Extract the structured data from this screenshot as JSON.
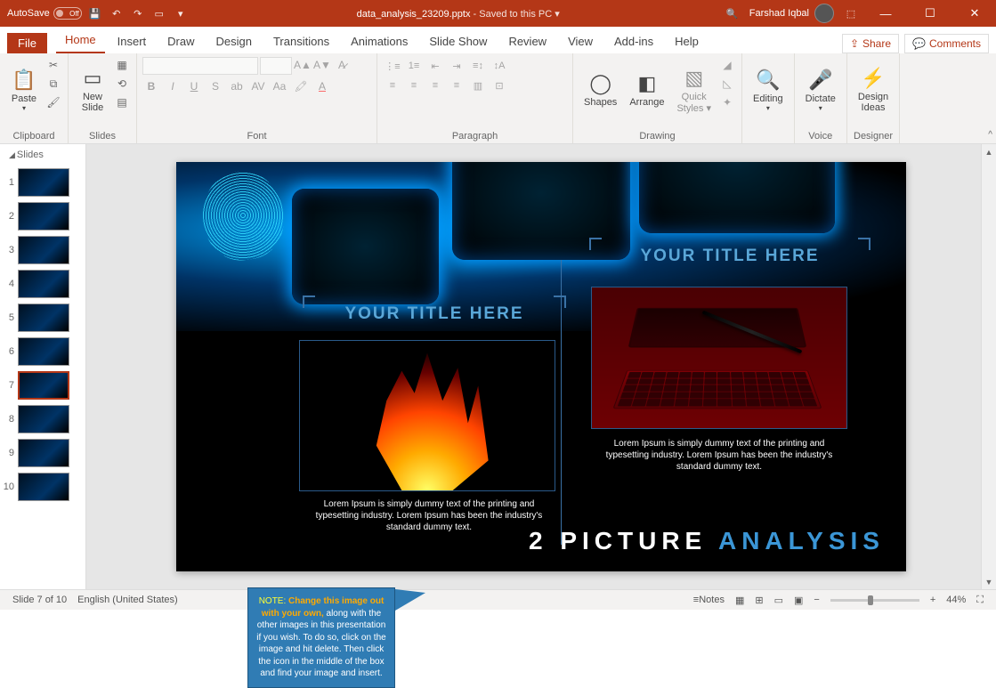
{
  "titlebar": {
    "autosave_label": "AutoSave",
    "autosave_state": "Off",
    "filename": "data_analysis_23209.pptx",
    "saved_status": " - Saved to this PC ▾",
    "user": "Farshad Iqbal"
  },
  "tabs": {
    "file": "File",
    "items": [
      "Home",
      "Insert",
      "Draw",
      "Design",
      "Transitions",
      "Animations",
      "Slide Show",
      "Review",
      "View",
      "Add-ins",
      "Help"
    ],
    "share": "Share",
    "comments": "Comments"
  },
  "ribbon": {
    "clipboard": {
      "label": "Clipboard",
      "paste": "Paste"
    },
    "slides": {
      "label": "Slides",
      "new_slide": "New\nSlide"
    },
    "font": {
      "label": "Font"
    },
    "paragraph": {
      "label": "Paragraph"
    },
    "drawing": {
      "label": "Drawing",
      "shapes": "Shapes",
      "arrange": "Arrange",
      "quick": "Quick\nStyles ▾"
    },
    "editing": {
      "label": "Editing",
      "btn": "Editing"
    },
    "voice": {
      "label": "Voice",
      "dictate": "Dictate"
    },
    "designer": {
      "label": "Designer",
      "ideas": "Design\nIdeas"
    }
  },
  "thumbs": {
    "header": "Slides",
    "count": 10,
    "active": 7
  },
  "slide": {
    "left_title": "YOUR TITLE HERE",
    "right_title": "YOUR TITLE HERE",
    "desc_left": "Lorem Ipsum is simply dummy text of the printing and typesetting industry. Lorem Ipsum has been the industry's standard dummy text.",
    "desc_right": "Lorem Ipsum is simply dummy text of the printing and typesetting industry. Lorem Ipsum has been the industry's standard dummy text.",
    "heading_a": "2 PICTURE ",
    "heading_b": "ANALYSIS"
  },
  "note": {
    "prefix": "NOTE:",
    "bold": " Change this image out with your own,",
    "rest": " along with the other images in this presentation if you wish. To do so, click on the image and hit delete. Then click the  icon in the middle of the box and find your image and insert."
  },
  "status": {
    "slide_indicator": "Slide 7 of 10",
    "language": "English (United States)",
    "notes": "Notes",
    "zoom": "44%"
  }
}
